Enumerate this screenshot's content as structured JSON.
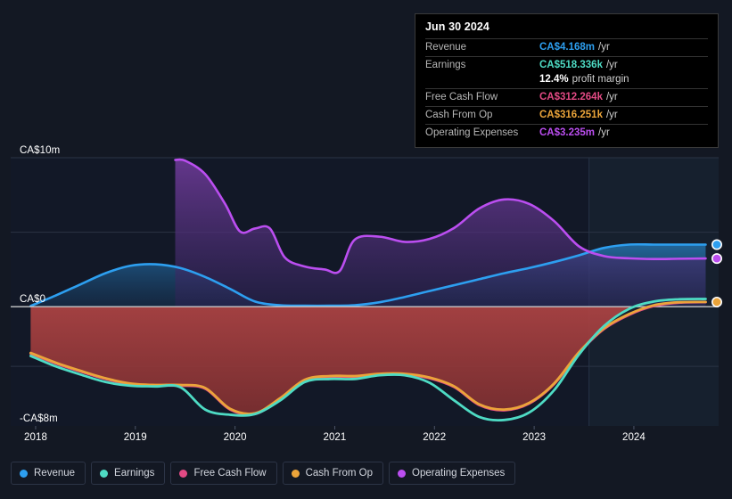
{
  "chart_data": {
    "type": "area",
    "title": "",
    "xlabel": "",
    "ylabel": "",
    "currency": "CA$",
    "ylim": [
      -8,
      10
    ],
    "xlim": [
      2017.75,
      2024.85
    ],
    "grid": true,
    "gridlines": [
      10,
      5,
      0,
      -4
    ],
    "y_ticks": [
      {
        "value": 10,
        "label": "CA$10m"
      },
      {
        "value": 0,
        "label": "CA$0"
      },
      {
        "value": -8,
        "label": "-CA$8m"
      }
    ],
    "x_ticks": [
      {
        "value": 2018,
        "label": "2018"
      },
      {
        "value": 2019,
        "label": "2019"
      },
      {
        "value": 2020,
        "label": "2020"
      },
      {
        "value": 2021,
        "label": "2021"
      },
      {
        "value": 2022,
        "label": "2022"
      },
      {
        "value": 2023,
        "label": "2023"
      },
      {
        "value": 2024,
        "label": "2024"
      }
    ],
    "forecast_start": 2023.55,
    "legend_position": "bottom",
    "series": [
      {
        "name": "Revenue",
        "color": "#2d9ff0",
        "x": [
          2017.95,
          2018.2,
          2018.45,
          2018.7,
          2018.95,
          2019.2,
          2019.45,
          2019.7,
          2019.95,
          2020.2,
          2020.45,
          2020.7,
          2020.95,
          2021.2,
          2021.45,
          2021.7,
          2021.95,
          2022.2,
          2022.45,
          2022.7,
          2022.95,
          2023.2,
          2023.45,
          2023.7,
          2023.95,
          2024.2,
          2024.45,
          2024.72
        ],
        "values": [
          0.05,
          0.75,
          1.5,
          2.25,
          2.75,
          2.85,
          2.6,
          2.0,
          1.2,
          0.35,
          0.1,
          0.07,
          0.07,
          0.1,
          0.3,
          0.65,
          1.05,
          1.45,
          1.85,
          2.25,
          2.6,
          3.0,
          3.45,
          3.95,
          4.17,
          4.17,
          4.17,
          4.17
        ]
      },
      {
        "name": "Earnings",
        "color": "#4edbc4",
        "x": [
          2017.95,
          2018.2,
          2018.45,
          2018.7,
          2018.95,
          2019.2,
          2019.45,
          2019.7,
          2019.95,
          2020.2,
          2020.45,
          2020.7,
          2020.95,
          2021.2,
          2021.45,
          2021.7,
          2021.95,
          2022.2,
          2022.45,
          2022.7,
          2022.95,
          2023.2,
          2023.45,
          2023.7,
          2023.95,
          2024.2,
          2024.45,
          2024.72
        ],
        "values": [
          -3.3,
          -4.0,
          -4.55,
          -5.05,
          -5.3,
          -5.35,
          -5.4,
          -6.9,
          -7.25,
          -7.2,
          -6.3,
          -5.05,
          -4.85,
          -4.85,
          -4.6,
          -4.6,
          -5.1,
          -6.3,
          -7.4,
          -7.6,
          -7.1,
          -5.6,
          -3.2,
          -1.3,
          -0.15,
          0.35,
          0.5,
          0.52
        ]
      },
      {
        "name": "Free Cash Flow",
        "color": "#e24a84",
        "x": [
          2017.95,
          2018.2,
          2018.45,
          2018.7,
          2018.95,
          2019.2,
          2019.45,
          2019.7,
          2019.95,
          2020.2,
          2020.45,
          2020.7,
          2020.95,
          2021.2,
          2021.45,
          2021.7,
          2021.95,
          2022.2,
          2022.45,
          2022.7,
          2022.95,
          2023.2,
          2023.45,
          2023.7,
          2023.95,
          2024.2,
          2024.45,
          2024.72
        ],
        "values": [
          -3.15,
          -3.8,
          -4.35,
          -4.85,
          -5.2,
          -5.3,
          -5.3,
          -5.5,
          -6.9,
          -7.2,
          -6.2,
          -4.95,
          -4.7,
          -4.7,
          -4.55,
          -4.55,
          -4.8,
          -5.4,
          -6.6,
          -6.95,
          -6.5,
          -5.2,
          -3.1,
          -1.5,
          -0.55,
          0.05,
          0.27,
          0.31
        ]
      },
      {
        "name": "Cash From Op",
        "color": "#eba43a",
        "x": [
          2017.95,
          2018.2,
          2018.45,
          2018.7,
          2018.95,
          2019.2,
          2019.45,
          2019.7,
          2019.95,
          2020.2,
          2020.45,
          2020.7,
          2020.95,
          2021.2,
          2021.45,
          2021.7,
          2021.95,
          2022.2,
          2022.45,
          2022.7,
          2022.95,
          2023.2,
          2023.45,
          2023.7,
          2023.95,
          2024.2,
          2024.45,
          2024.72
        ],
        "values": [
          -3.1,
          -3.75,
          -4.3,
          -4.8,
          -5.15,
          -5.25,
          -5.25,
          -5.45,
          -6.85,
          -7.15,
          -6.15,
          -4.9,
          -4.65,
          -4.65,
          -4.5,
          -4.5,
          -4.75,
          -5.35,
          -6.55,
          -6.9,
          -6.45,
          -5.15,
          -3.05,
          -1.45,
          -0.5,
          0.1,
          0.3,
          0.32
        ]
      },
      {
        "name": "Operating Expenses",
        "color": "#bb4ef0",
        "x": [
          2019.4,
          2019.5,
          2019.7,
          2019.9,
          2020.05,
          2020.2,
          2020.35,
          2020.5,
          2020.7,
          2020.9,
          2021.05,
          2021.2,
          2021.45,
          2021.7,
          2021.95,
          2022.2,
          2022.45,
          2022.7,
          2022.95,
          2023.2,
          2023.45,
          2023.7,
          2023.95,
          2024.2,
          2024.45,
          2024.72
        ],
        "values": [
          9.85,
          9.8,
          8.9,
          6.9,
          5.05,
          5.25,
          5.25,
          3.3,
          2.7,
          2.5,
          2.4,
          4.5,
          4.7,
          4.35,
          4.55,
          5.3,
          6.6,
          7.2,
          6.9,
          5.75,
          4.05,
          3.4,
          3.25,
          3.2,
          3.22,
          3.24
        ]
      }
    ],
    "endpoints": [
      {
        "name": "Revenue",
        "value": 4.168,
        "color": "#2d9ff0"
      },
      {
        "name": "Operating Expenses",
        "value": 3.235,
        "color": "#bb4ef0"
      },
      {
        "name": "Cash From Op",
        "value": 0.316,
        "color": "#eba43a"
      }
    ]
  },
  "tooltip": {
    "date": "Jun 30 2024",
    "rows": [
      {
        "label": "Revenue",
        "value": "CA$4.168m",
        "unit": "/yr",
        "color": "#2d9ff0"
      },
      {
        "label": "Earnings",
        "value": "CA$518.336k",
        "unit": "/yr",
        "color": "#4edbc4"
      },
      {
        "label": "Free Cash Flow",
        "value": "CA$312.264k",
        "unit": "/yr",
        "color": "#e24a84"
      },
      {
        "label": "Cash From Op",
        "value": "CA$316.251k",
        "unit": "/yr",
        "color": "#eba43a"
      },
      {
        "label": "Operating Expenses",
        "value": "CA$3.235m",
        "unit": "/yr",
        "color": "#bb4ef0"
      }
    ],
    "profit_margin_value": "12.4%",
    "profit_margin_text": "profit margin"
  },
  "legend": {
    "items": [
      {
        "label": "Revenue",
        "color": "#2d9ff0"
      },
      {
        "label": "Earnings",
        "color": "#4edbc4"
      },
      {
        "label": "Free Cash Flow",
        "color": "#e24a84"
      },
      {
        "label": "Cash From Op",
        "color": "#eba43a"
      },
      {
        "label": "Operating Expenses",
        "color": "#bb4ef0"
      }
    ]
  },
  "colors": {
    "page_background": "#131823",
    "plot_background": "#121827",
    "forecast_background": "#16202e",
    "negative_band": "#8e3535",
    "gridline": "#2b3344",
    "zero_line": "#c8c8c8"
  }
}
